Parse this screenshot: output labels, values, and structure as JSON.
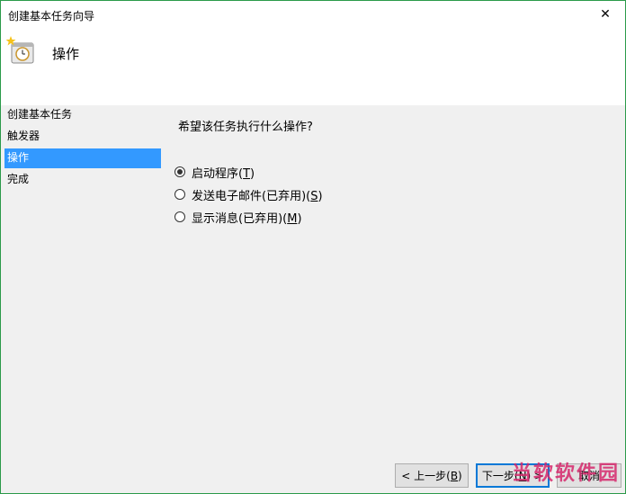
{
  "window": {
    "title": "创建基本任务向导",
    "close_symbol": "✕"
  },
  "header": {
    "title": "操作",
    "icon": "task-scheduler-icon"
  },
  "nav": {
    "items": [
      {
        "label": "创建基本任务",
        "selected": false
      },
      {
        "label": "触发器",
        "selected": false
      },
      {
        "label": "操作",
        "selected": true
      },
      {
        "label": "完成",
        "selected": false
      }
    ]
  },
  "content": {
    "question": "希望该任务执行什么操作?",
    "options": [
      {
        "label": "启动程序(",
        "key": "T",
        "suffix": ")",
        "checked": true
      },
      {
        "label": "发送电子邮件(已弃用)(",
        "key": "S",
        "suffix": ")",
        "checked": false
      },
      {
        "label": "显示消息(已弃用)(",
        "key": "M",
        "suffix": ")",
        "checked": false
      }
    ]
  },
  "footer": {
    "back": {
      "label": "< 上一步(",
      "key": "B",
      "suffix": ")"
    },
    "next": {
      "label": "下一步(",
      "key": "N",
      "suffix": ") >"
    },
    "cancel": {
      "label": "取消"
    }
  },
  "watermark": "当软软件园",
  "colors": {
    "selection": "#3399ff",
    "window_border": "#2b9a4a",
    "default_button_border": "#0078d7"
  }
}
